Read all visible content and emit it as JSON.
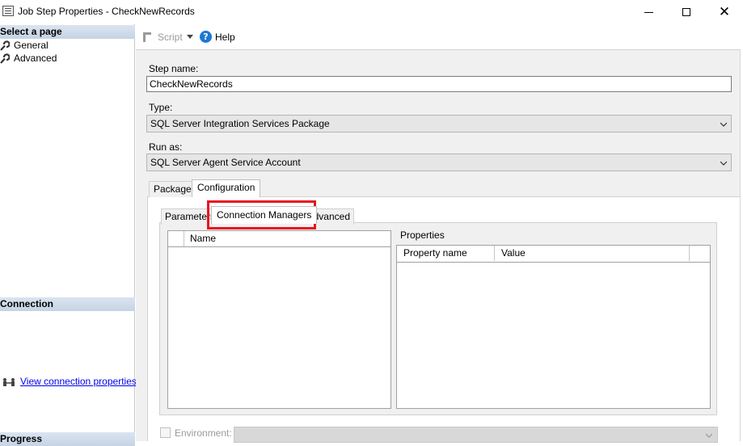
{
  "window": {
    "title": "Job Step Properties - CheckNewRecords"
  },
  "left_panel": {
    "select_page_header": "Select a page",
    "pages": [
      {
        "label": "General",
        "icon": "wrench-icon"
      },
      {
        "label": "Advanced",
        "icon": "wrench-icon"
      }
    ],
    "connection_header": "Connection",
    "view_connection_link": "View connection properties",
    "progress_header": "Progress"
  },
  "toolbar": {
    "script_label": "Script",
    "help_label": "Help"
  },
  "form": {
    "step_name_label": "Step name:",
    "step_name_value": "CheckNewRecords",
    "type_label": "Type:",
    "type_value": "SQL Server Integration Services Package",
    "run_as_label": "Run as:",
    "run_as_value": "SQL Server Agent Service Account"
  },
  "outer_tabs": [
    {
      "label": "Package",
      "active": false
    },
    {
      "label": "Configuration",
      "active": true
    }
  ],
  "inner_tabs": [
    {
      "label": "Parameters",
      "active": false
    },
    {
      "label": "Connection Managers",
      "active": true
    },
    {
      "label": "Advanced",
      "active": false
    }
  ],
  "connection_grid": {
    "columns": [
      "Name"
    ]
  },
  "properties": {
    "label": "Properties",
    "columns": [
      "Property name",
      "Value"
    ]
  },
  "environment": {
    "label": "Environment:",
    "checked": false
  },
  "colors": {
    "highlight": "#e8141f",
    "link": "#0000ee",
    "section_header": "#c5d3e4"
  }
}
